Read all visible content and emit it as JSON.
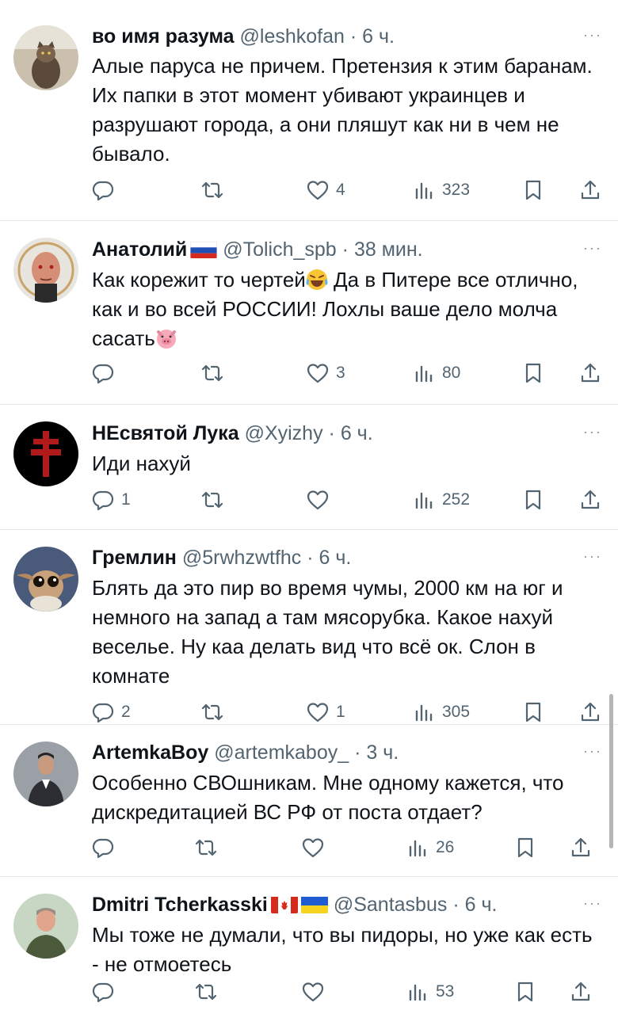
{
  "tweets": [
    {
      "name": "во имя разума",
      "handle": "@leshkofan",
      "time": "6 ч.",
      "text": "Алые паруса не причем. Претензия к этим баранам. Их папки в этот момент убивают украинцев и разрушают города, а они пляшут как ни в чем не бывало.",
      "replies": "",
      "retweets": "",
      "likes": "4",
      "views": "323",
      "avatar_color": "#c8b9a6"
    },
    {
      "name": "Анатолий",
      "handle": "@Tolich_spb",
      "time": "38 мин.",
      "text_part1": "Как корежит то чертей",
      "text_part2": " Да в Питере все отлично, как и во всей РОССИИ! Лохлы ваше дело молча сасать",
      "replies": "",
      "retweets": "",
      "likes": "3",
      "views": "80",
      "avatar_color": "#d9a48a"
    },
    {
      "name": "НЕсвятой Лука",
      "handle": "@Xyizhy",
      "time": "6 ч.",
      "text": "Иди нахуй",
      "replies": "1",
      "retweets": "",
      "likes": "",
      "views": "252",
      "avatar_color": "#000000"
    },
    {
      "name": "Гремлин",
      "handle": "@5rwhzwtfhc",
      "time": "6 ч.",
      "text": "Блять да это пир во время чумы, 2000 км на юг и немного на запад а там мясорубка. Какое нахуй веселье. Ну каа делать вид что всё ок. Слон в комнате",
      "replies": "2",
      "retweets": "",
      "likes": "1",
      "views": "305",
      "avatar_color": "#6b5a48"
    },
    {
      "name": "ArtemkaBoy",
      "handle": "@artemkaboy_",
      "time": "3 ч.",
      "text": "Особенно СВОшникам. Мне одному кажется, что дискредитацией ВС РФ от поста отдает?",
      "replies": "",
      "retweets": "",
      "likes": "",
      "views": "26",
      "avatar_color": "#8a8f96"
    },
    {
      "name": "Dmitri Tcherkasski",
      "handle": "@Santasbus",
      "time": "6 ч.",
      "text": "Мы тоже не думали, что вы пидоры, но уже как есть - не отмоетесь",
      "replies": "",
      "retweets": "",
      "likes": "",
      "views": "53",
      "avatar_color": "#a7b8a0"
    }
  ],
  "meta_separator": "·",
  "more_glyph": "···",
  "colors": {
    "text": "#0f1419",
    "secondary": "#536471",
    "divider": "#e6e6e6"
  },
  "icons": [
    "reply-icon",
    "retweet-icon",
    "like-icon",
    "views-icon",
    "bookmark-icon",
    "share-icon",
    "more-icon"
  ]
}
